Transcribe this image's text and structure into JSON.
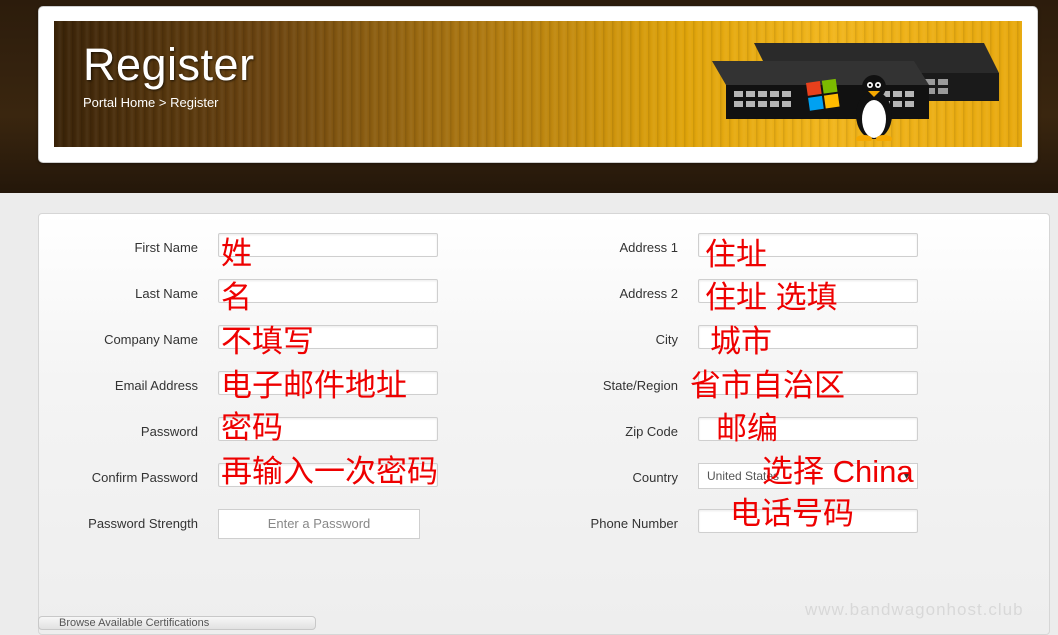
{
  "header": {
    "title": "Register",
    "breadcrumb_home": "Portal Home",
    "breadcrumb_sep": ">",
    "breadcrumb_current": "Register"
  },
  "form": {
    "left_fields": [
      {
        "label": "First Name",
        "value": ""
      },
      {
        "label": "Last Name",
        "value": ""
      },
      {
        "label": "Company Name",
        "value": ""
      },
      {
        "label": "Email Address",
        "value": ""
      },
      {
        "label": "Password",
        "value": ""
      },
      {
        "label": "Confirm Password",
        "value": ""
      }
    ],
    "password_strength": {
      "label": "Password Strength",
      "text": "Enter a Password"
    },
    "right_fields": [
      {
        "label": "Address 1",
        "value": ""
      },
      {
        "label": "Address 2",
        "value": ""
      },
      {
        "label": "City",
        "value": ""
      },
      {
        "label": "State/Region",
        "value": ""
      },
      {
        "label": "Zip Code",
        "value": ""
      },
      {
        "label": "Country",
        "value": "United States"
      },
      {
        "label": "Phone Number",
        "value": ""
      }
    ]
  },
  "annotations": {
    "first_name": "姓",
    "last_name": "名",
    "company": "不填写",
    "email": "电子邮件地址",
    "password": "密码",
    "confirm": "再输入一次密码",
    "address1": "住址",
    "address2": "住址 选填",
    "city": "城市",
    "state": "省市自治区",
    "zip": "邮编",
    "country": "选择 China",
    "phone": "电话号码"
  },
  "bottom_button": "Browse Available Certifications",
  "watermark": "www.bandwagonhost.club",
  "colors": {
    "annotation": "#ee0000",
    "banner_accent": "#f1b51b"
  }
}
